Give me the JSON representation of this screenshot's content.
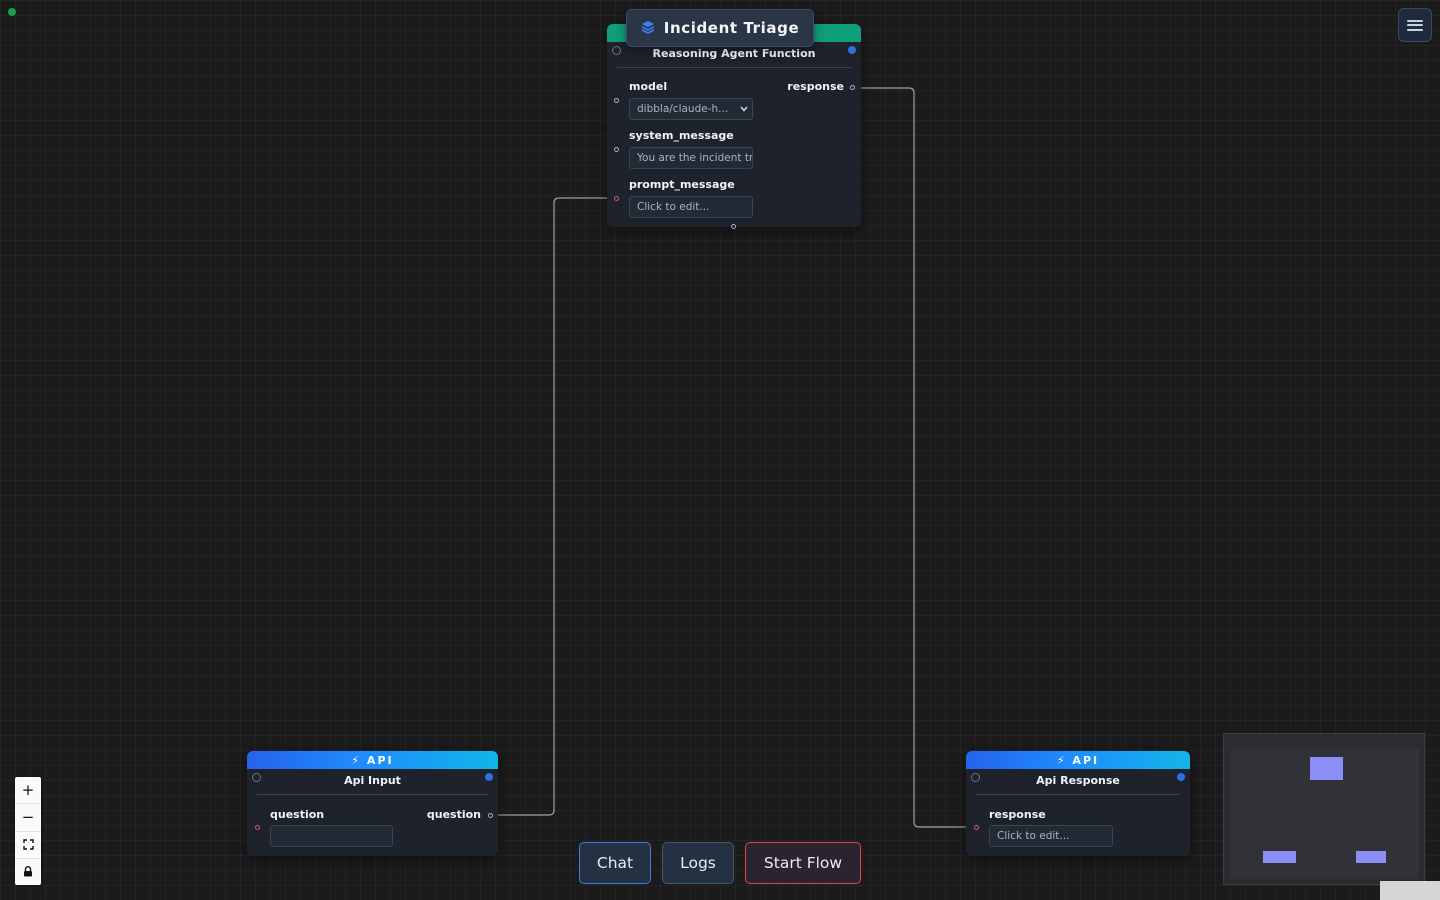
{
  "flow": {
    "title": "Incident Triage",
    "title_icon": "layers-icon"
  },
  "nodes": {
    "reasoning": {
      "header_color": "#0f9f7a",
      "title": "Reasoning Agent Function",
      "fields": {
        "model_label": "model",
        "model_value": "dibbla/claude-h...",
        "system_message_label": "system_message",
        "system_message_value": "You are the incident tri",
        "prompt_message_label": "prompt_message",
        "prompt_message_placeholder": "Click to edit..."
      },
      "output_label": "response"
    },
    "api_input": {
      "badge": "⚡ API",
      "title": "Api Input",
      "input_label": "question",
      "input_value": "",
      "output_label": "question"
    },
    "api_response": {
      "badge": "⚡ API",
      "title": "Api Response",
      "input_label": "response",
      "input_placeholder": "Click to edit..."
    }
  },
  "toolbar": {
    "chat_label": "Chat",
    "logs_label": "Logs",
    "start_flow_label": "Start Flow"
  },
  "zoom_controls": {
    "zoom_in": "+",
    "zoom_out": "−",
    "fit_view_icon": "fit-view-icon",
    "lock_icon": "lock-icon"
  },
  "colors": {
    "accent_blue": "#3d7be6",
    "danger_red": "#e0434f",
    "status_green": "#16a34a",
    "minimap_node": "#8b8ff5"
  }
}
